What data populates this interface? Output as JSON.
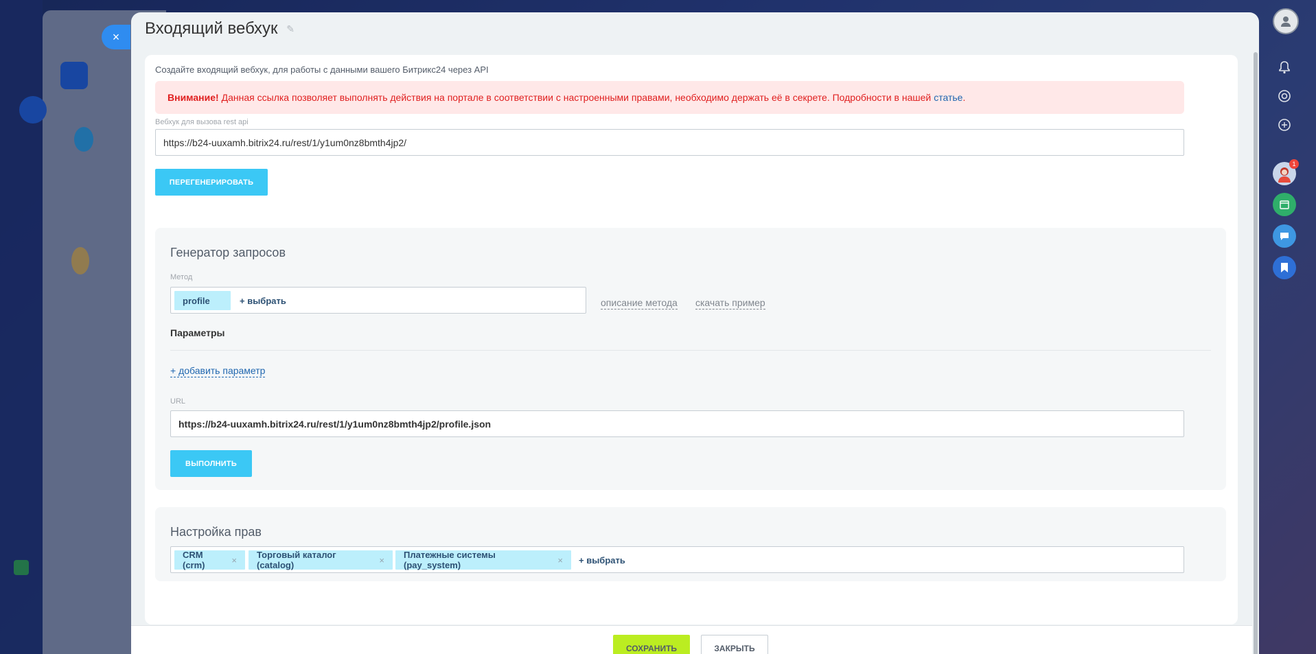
{
  "panel": {
    "title": "Входящий вебхук"
  },
  "intro_text": "Создайте входящий вебхук, для работы с данными вашего Битрикс24 через API",
  "alert": {
    "bold": "Внимание!",
    "text": "Данная ссылка позволяет выполнять действия на портале в соответствии с настроенными правами, необходимо держать её в секрете. Подробности в нашей",
    "link": "статье",
    "tail": "."
  },
  "webhook": {
    "label": "Вебхук для вызова rest api",
    "value": "https://b24-uuxamh.bitrix24.ru/rest/1/y1um0nz8bmth4jp2/",
    "regenerate_label": "ПЕРЕГЕНЕРИРОВАТЬ"
  },
  "generator": {
    "title": "Генератор запросов",
    "method_label": "Метод",
    "method_tag": "profile",
    "select_label": "+ выбрать",
    "method_description": "описание метода",
    "download_example": "скачать пример",
    "params_title": "Параметры",
    "add_param": "+ добавить параметр",
    "url_label": "URL",
    "url_value": "https://b24-uuxamh.bitrix24.ru/rest/1/y1um0nz8bmth4jp2/profile.json",
    "execute_label": "ВЫПОЛНИТЬ"
  },
  "rights": {
    "title": "Настройка прав",
    "tags": [
      {
        "label": "CRM (crm)"
      },
      {
        "label": "Торговый каталог (catalog)"
      },
      {
        "label": "Платежные системы (pay_system)"
      }
    ],
    "remove_glyph": "×",
    "select_label": "+ выбрать"
  },
  "footer": {
    "save_label": "СОХРАНИТЬ",
    "close_label": "ЗАКРЫТЬ"
  },
  "icons": {
    "close": "×",
    "pencil": "✎",
    "bell": "bell-icon",
    "notification_count": "1"
  },
  "colors": {
    "accent_blue": "#3bc8f5",
    "save_green": "#bbed21",
    "alert_bg": "#ffe8e8",
    "alert_text": "#e02020",
    "tag_bg": "#bceffc"
  }
}
